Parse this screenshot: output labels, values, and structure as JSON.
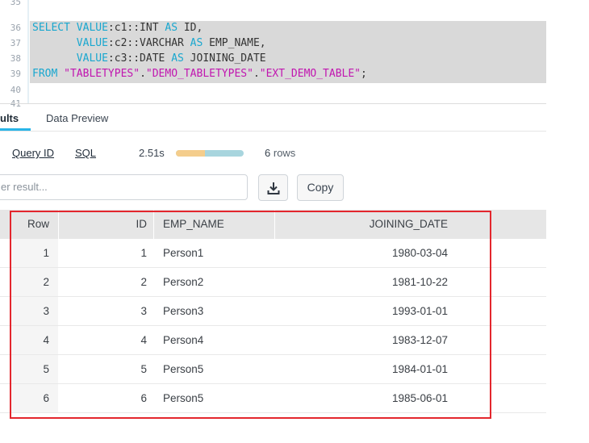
{
  "editor": {
    "line_numbers": [
      "35",
      "36",
      "37",
      "38",
      "39",
      "40",
      "41"
    ],
    "lines": [
      [
        {
          "t": "SELECT VALUE",
          "c": "kw"
        },
        {
          "t": ":c1::INT ",
          "c": ""
        },
        {
          "t": "AS",
          "c": "kw"
        },
        {
          "t": " ID,",
          "c": ""
        }
      ],
      [
        {
          "t": "       VALUE",
          "c": "kw"
        },
        {
          "t": ":c2::VARCHAR ",
          "c": ""
        },
        {
          "t": "AS",
          "c": "kw"
        },
        {
          "t": " EMP_NAME,",
          "c": ""
        }
      ],
      [
        {
          "t": "       VALUE",
          "c": "kw"
        },
        {
          "t": ":c3::DATE ",
          "c": ""
        },
        {
          "t": "AS",
          "c": "kw"
        },
        {
          "t": " JOINING_DATE",
          "c": ""
        }
      ],
      [
        {
          "t": "FROM ",
          "c": "kw"
        },
        {
          "t": "\"TABLETYPES\"",
          "c": "str"
        },
        {
          "t": ".",
          "c": ""
        },
        {
          "t": "\"DEMO_TABLETYPES\"",
          "c": "str"
        },
        {
          "t": ".",
          "c": ""
        },
        {
          "t": "\"EXT_DEMO_TABLE\"",
          "c": "str"
        },
        {
          "t": ";",
          "c": ""
        }
      ]
    ]
  },
  "tabs": {
    "results": "ults",
    "preview": "Data Preview"
  },
  "info": {
    "query_id": "Query ID",
    "sql": "SQL",
    "duration": "2.51s",
    "duration_split": 0.43,
    "row_count": "6",
    "rows_label": "rows"
  },
  "filter": {
    "placeholder": "er result..."
  },
  "buttons": {
    "download_icon": "download-icon",
    "copy": "Copy"
  },
  "colors": {
    "keyword": "#19a7cf",
    "string": "#c116b0",
    "accent": "#29b5e8",
    "highlight_border": "#e3262d"
  },
  "table": {
    "columns": [
      "Row",
      "ID",
      "EMP_NAME",
      "JOINING_DATE"
    ],
    "rows": [
      [
        "1",
        "1",
        "Person1",
        "1980-03-04"
      ],
      [
        "2",
        "2",
        "Person2",
        "1981-10-22"
      ],
      [
        "3",
        "3",
        "Person3",
        "1993-01-01"
      ],
      [
        "4",
        "4",
        "Person4",
        "1983-12-07"
      ],
      [
        "5",
        "5",
        "Person5",
        "1984-01-01"
      ],
      [
        "6",
        "6",
        "Person5",
        "1985-06-01"
      ]
    ]
  }
}
